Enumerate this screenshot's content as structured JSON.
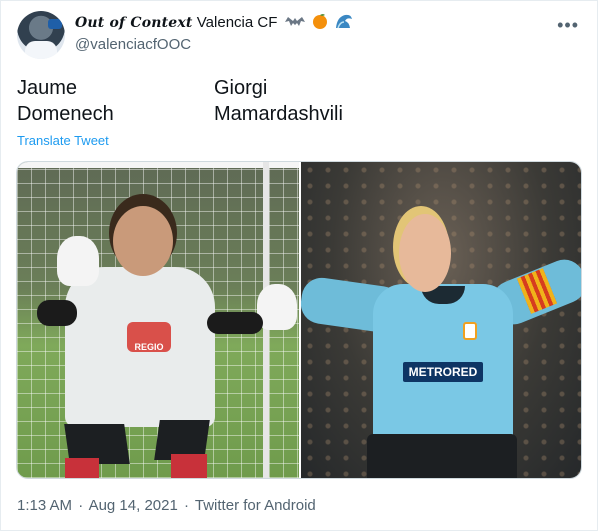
{
  "tweet": {
    "author": {
      "display_name_styled": "Out of Context",
      "display_name_club": "Valencia CF",
      "handle": "@valenciacfOOC",
      "emojis": [
        "bat-icon",
        "orange-icon",
        "wave-icon"
      ]
    },
    "text": {
      "left_column": [
        "Jaume",
        "Domenech"
      ],
      "right_column": [
        "Giorgi",
        "Mamardashvili"
      ]
    },
    "translate_label": "Translate Tweet",
    "media": {
      "left_image_sponsor": "REGIO",
      "right_image_sponsor": "METRORED"
    },
    "meta": {
      "time": "1:13 AM",
      "separator": "·",
      "date": "Aug 14, 2021",
      "source": "Twitter for Android"
    }
  },
  "colors": {
    "link": "#1d9bf0",
    "secondary_text": "#536471",
    "border": "#cfd9de"
  }
}
